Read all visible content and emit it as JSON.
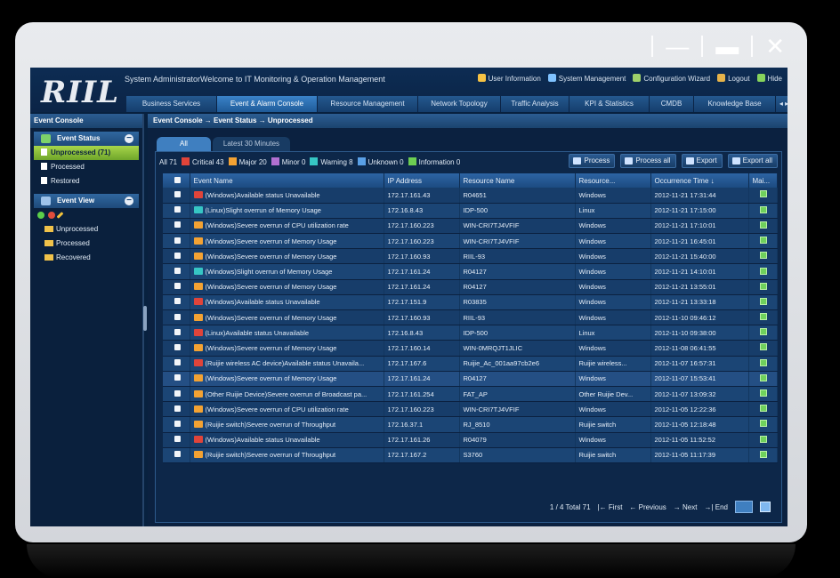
{
  "window_controls": {
    "minimize": "—",
    "restore": "▬",
    "close": "✕"
  },
  "app": {
    "logo": "RIIL",
    "welcome": "System AdministratorWelcome to IT Monitoring & Operation Management",
    "top_links": [
      {
        "label": "User Information",
        "color": "#f6c244"
      },
      {
        "label": "System Management",
        "color": "#7fc2ff"
      },
      {
        "label": "Configuration Wizard",
        "color": "#9fd06a"
      },
      {
        "label": "Logout",
        "color": "#e6b34a"
      },
      {
        "label": "Hide",
        "color": "#86d35c"
      }
    ],
    "nav_tabs": [
      "Business Services",
      "Event & Alarm Console",
      "Resource Management",
      "Network Topology",
      "Traffic Analysis",
      "KPI & Statistics",
      "CMDB",
      "Knowledge Base"
    ],
    "nav_more": "◂ ▸",
    "active_nav": 1
  },
  "sidebar": {
    "title": "Event Console",
    "event_status": {
      "header": "Event Status",
      "items": [
        "Unprocessed (71)",
        "Processed",
        "Restored"
      ],
      "selected": 0
    },
    "event_view": {
      "header": "Event View",
      "folders": [
        "Unprocessed",
        "Processed",
        "Recovered"
      ]
    }
  },
  "main": {
    "breadcrumb": "Event Console  →  Event Status  →  Unprocessed",
    "subtabs": [
      "All",
      "Latest 30 Minutes"
    ],
    "legend_all": "All 71",
    "legend": [
      {
        "label": "Critical 43",
        "color": "#e0443a"
      },
      {
        "label": "Major 20",
        "color": "#f3a233"
      },
      {
        "label": "Minor 0",
        "color": "#b270d1"
      },
      {
        "label": "Warning 8",
        "color": "#36c6c4"
      },
      {
        "label": "Unknown 0",
        "color": "#5aa0e6"
      },
      {
        "label": "Information 0",
        "color": "#6dce52"
      }
    ],
    "actions": [
      "Process",
      "Process all",
      "Export",
      "Export all"
    ],
    "columns": [
      "Event Name",
      "IP Address",
      "Resource Name",
      "Resource...",
      "Occurrence Time  ↓",
      "Mai..."
    ],
    "rows": [
      {
        "sev": "#e0443a",
        "name": "(Windows)Available status Unavailable",
        "ip": "172.17.161.43",
        "res": "R04651",
        "type": "Windows",
        "time": "2012-11-21 17:31:44"
      },
      {
        "sev": "#36c6c4",
        "name": "(Linux)Slight overrun of Memory Usage",
        "ip": "172.16.8.43",
        "res": "IDP-500",
        "type": "Linux",
        "time": "2012-11-21 17:15:00"
      },
      {
        "sev": "#f3a233",
        "name": "(Windows)Severe overrun of CPU utilization rate",
        "ip": "172.17.160.223",
        "res": "WIN-CRI7TJ4VFIF",
        "type": "Windows",
        "time": "2012-11-21 17:10:01"
      },
      {
        "sev": "#f3a233",
        "name": "(Windows)Severe overrun of Memory Usage",
        "ip": "172.17.160.223",
        "res": "WIN-CRI7TJ4VFIF",
        "type": "Windows",
        "time": "2012-11-21 16:45:01"
      },
      {
        "sev": "#f3a233",
        "name": "(Windows)Severe overrun of Memory Usage",
        "ip": "172.17.160.93",
        "res": "RIIL-93",
        "type": "Windows",
        "time": "2012-11-21 15:40:00"
      },
      {
        "sev": "#36c6c4",
        "name": "(Windows)Slight overrun of Memory Usage",
        "ip": "172.17.161.24",
        "res": "R04127",
        "type": "Windows",
        "time": "2012-11-21 14:10:01"
      },
      {
        "sev": "#f3a233",
        "name": "(Windows)Severe overrun of Memory Usage",
        "ip": "172.17.161.24",
        "res": "R04127",
        "type": "Windows",
        "time": "2012-11-21 13:55:01"
      },
      {
        "sev": "#e0443a",
        "name": "(Windows)Available status Unavailable",
        "ip": "172.17.151.9",
        "res": "R03835",
        "type": "Windows",
        "time": "2012-11-21 13:33:18"
      },
      {
        "sev": "#f3a233",
        "name": "(Windows)Severe overrun of Memory Usage",
        "ip": "172.17.160.93",
        "res": "RIIL-93",
        "type": "Windows",
        "time": "2012-11-10 09:46:12"
      },
      {
        "sev": "#e0443a",
        "name": "(Linux)Available status Unavailable",
        "ip": "172.16.8.43",
        "res": "IDP-500",
        "type": "Linux",
        "time": "2012-11-10 09:38:00"
      },
      {
        "sev": "#f3a233",
        "name": "(Windows)Severe overrun of Memory Usage",
        "ip": "172.17.160.14",
        "res": "WIN-0MRQJT1JLIC",
        "type": "Windows",
        "time": "2012-11-08 06:41:55"
      },
      {
        "sev": "#e0443a",
        "name": "(Ruijie wireless AC device)Available status Unavaila...",
        "ip": "172.17.167.6",
        "res": "Ruijie_Ac_001aa97cb2e6",
        "type": "Ruijie wireless...",
        "time": "2012-11-07 16:57:31"
      },
      {
        "sev": "#f3a233",
        "name": "(Windows)Severe overrun of Memory Usage",
        "ip": "172.17.161.24",
        "res": "R04127",
        "type": "Windows",
        "time": "2012-11-07 15:53:41"
      },
      {
        "sev": "#f3a233",
        "name": "(Other Ruijie Device)Severe overrun of Broadcast pa...",
        "ip": "172.17.161.254",
        "res": "FAT_AP",
        "type": "Other Ruijie Dev...",
        "time": "2012-11-07 13:09:32"
      },
      {
        "sev": "#f3a233",
        "name": "(Windows)Severe overrun of CPU utilization rate",
        "ip": "172.17.160.223",
        "res": "WIN-CRI7TJ4VFIF",
        "type": "Windows",
        "time": "2012-11-05 12:22:36"
      },
      {
        "sev": "#f3a233",
        "name": "(Ruijie switch)Severe overrun of Throughput",
        "ip": "172.16.37.1",
        "res": "RJ_8510",
        "type": "Ruijie switch",
        "time": "2012-11-05 12:18:48"
      },
      {
        "sev": "#e0443a",
        "name": "(Windows)Available status Unavailable",
        "ip": "172.17.161.26",
        "res": "R04079",
        "type": "Windows",
        "time": "2012-11-05 11:52:52"
      },
      {
        "sev": "#f3a233",
        "name": "(Ruijie switch)Severe overrun of Throughput",
        "ip": "172.17.167.2",
        "res": "S3760",
        "type": "Ruijie switch",
        "time": "2012-11-05 11:17:39"
      }
    ],
    "pager": {
      "info": "1 / 4 Total 71",
      "first": "|← First",
      "prev": "← Previous",
      "next": "→ Next",
      "end": "→| End"
    }
  }
}
